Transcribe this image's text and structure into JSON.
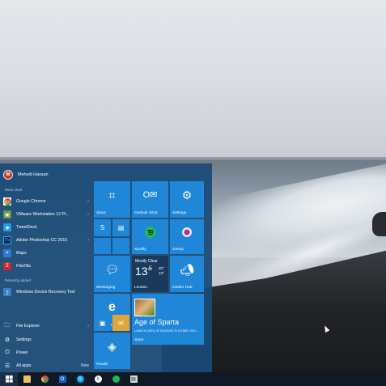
{
  "start_menu": {
    "user": {
      "name": "Mehedi Hassan"
    },
    "most_used_label": "Most used",
    "most_used": [
      {
        "label": "Google Chrome",
        "icon": "chrome-icon",
        "color": "#e8453c",
        "has_arrow": true
      },
      {
        "label": "VMware Workstation 12 Pl...",
        "icon": "vmware-icon",
        "color": "#6a9a3a",
        "has_arrow": true
      },
      {
        "label": "TweetDeck",
        "icon": "tweetdeck-icon",
        "color": "#1d9bf0",
        "has_arrow": false
      },
      {
        "label": "Adobe Photoshop CC 2015",
        "icon": "photoshop-icon",
        "color": "#0e2a47",
        "has_arrow": true
      },
      {
        "label": "Maps",
        "icon": "maps-icon",
        "color": "#2d7bd1",
        "has_arrow": false
      },
      {
        "label": "FileZilla",
        "icon": "filezilla-icon",
        "color": "#bf2b2b",
        "has_arrow": false
      }
    ],
    "recently_added_label": "Recently added",
    "recently_added": [
      {
        "label": "Windows Device Recovery Tool",
        "icon": "recovery-tool-icon",
        "color": "#3a7fc2"
      }
    ],
    "system": [
      {
        "label": "File Explorer",
        "icon": "folder-icon",
        "glyph": "🗀",
        "chev": "›"
      },
      {
        "label": "Settings",
        "icon": "gear-icon",
        "glyph": "⚙",
        "chev": ""
      },
      {
        "label": "Power",
        "icon": "power-icon",
        "glyph": "⏻",
        "chev": ""
      },
      {
        "label": "All apps",
        "icon": "all-apps-icon",
        "glyph": "☰",
        "chev": ""
      }
    ],
    "new_tag": "New",
    "tiles": {
      "slack": "Slack",
      "outlook": "Outlook 2016",
      "settings": "Settings",
      "spotify": "Spotify",
      "getup": "GetUp",
      "messaging": "Messaging",
      "weather": {
        "condition": "Mostly Clear",
        "temp": "13°",
        "unit": "C",
        "high": "20°",
        "low": "13°",
        "city": "London"
      },
      "insider_hub": "Insider Hub",
      "edge": "Microsoft Edge",
      "store": {
        "title": "Age of Sparta",
        "subtitle": "Lead an army of Spartans to reclaim Gre...",
        "label": "Store"
      },
      "readit": "Readit"
    }
  },
  "taskbar": {
    "items": [
      "windows-start",
      "file-explorer",
      "chrome",
      "outlook",
      "skype",
      "slack",
      "spotify",
      "readit"
    ]
  },
  "colors": {
    "start_bg": "#1a4a76",
    "tile": "#1f86d8",
    "taskbar": "#0f1a26"
  }
}
